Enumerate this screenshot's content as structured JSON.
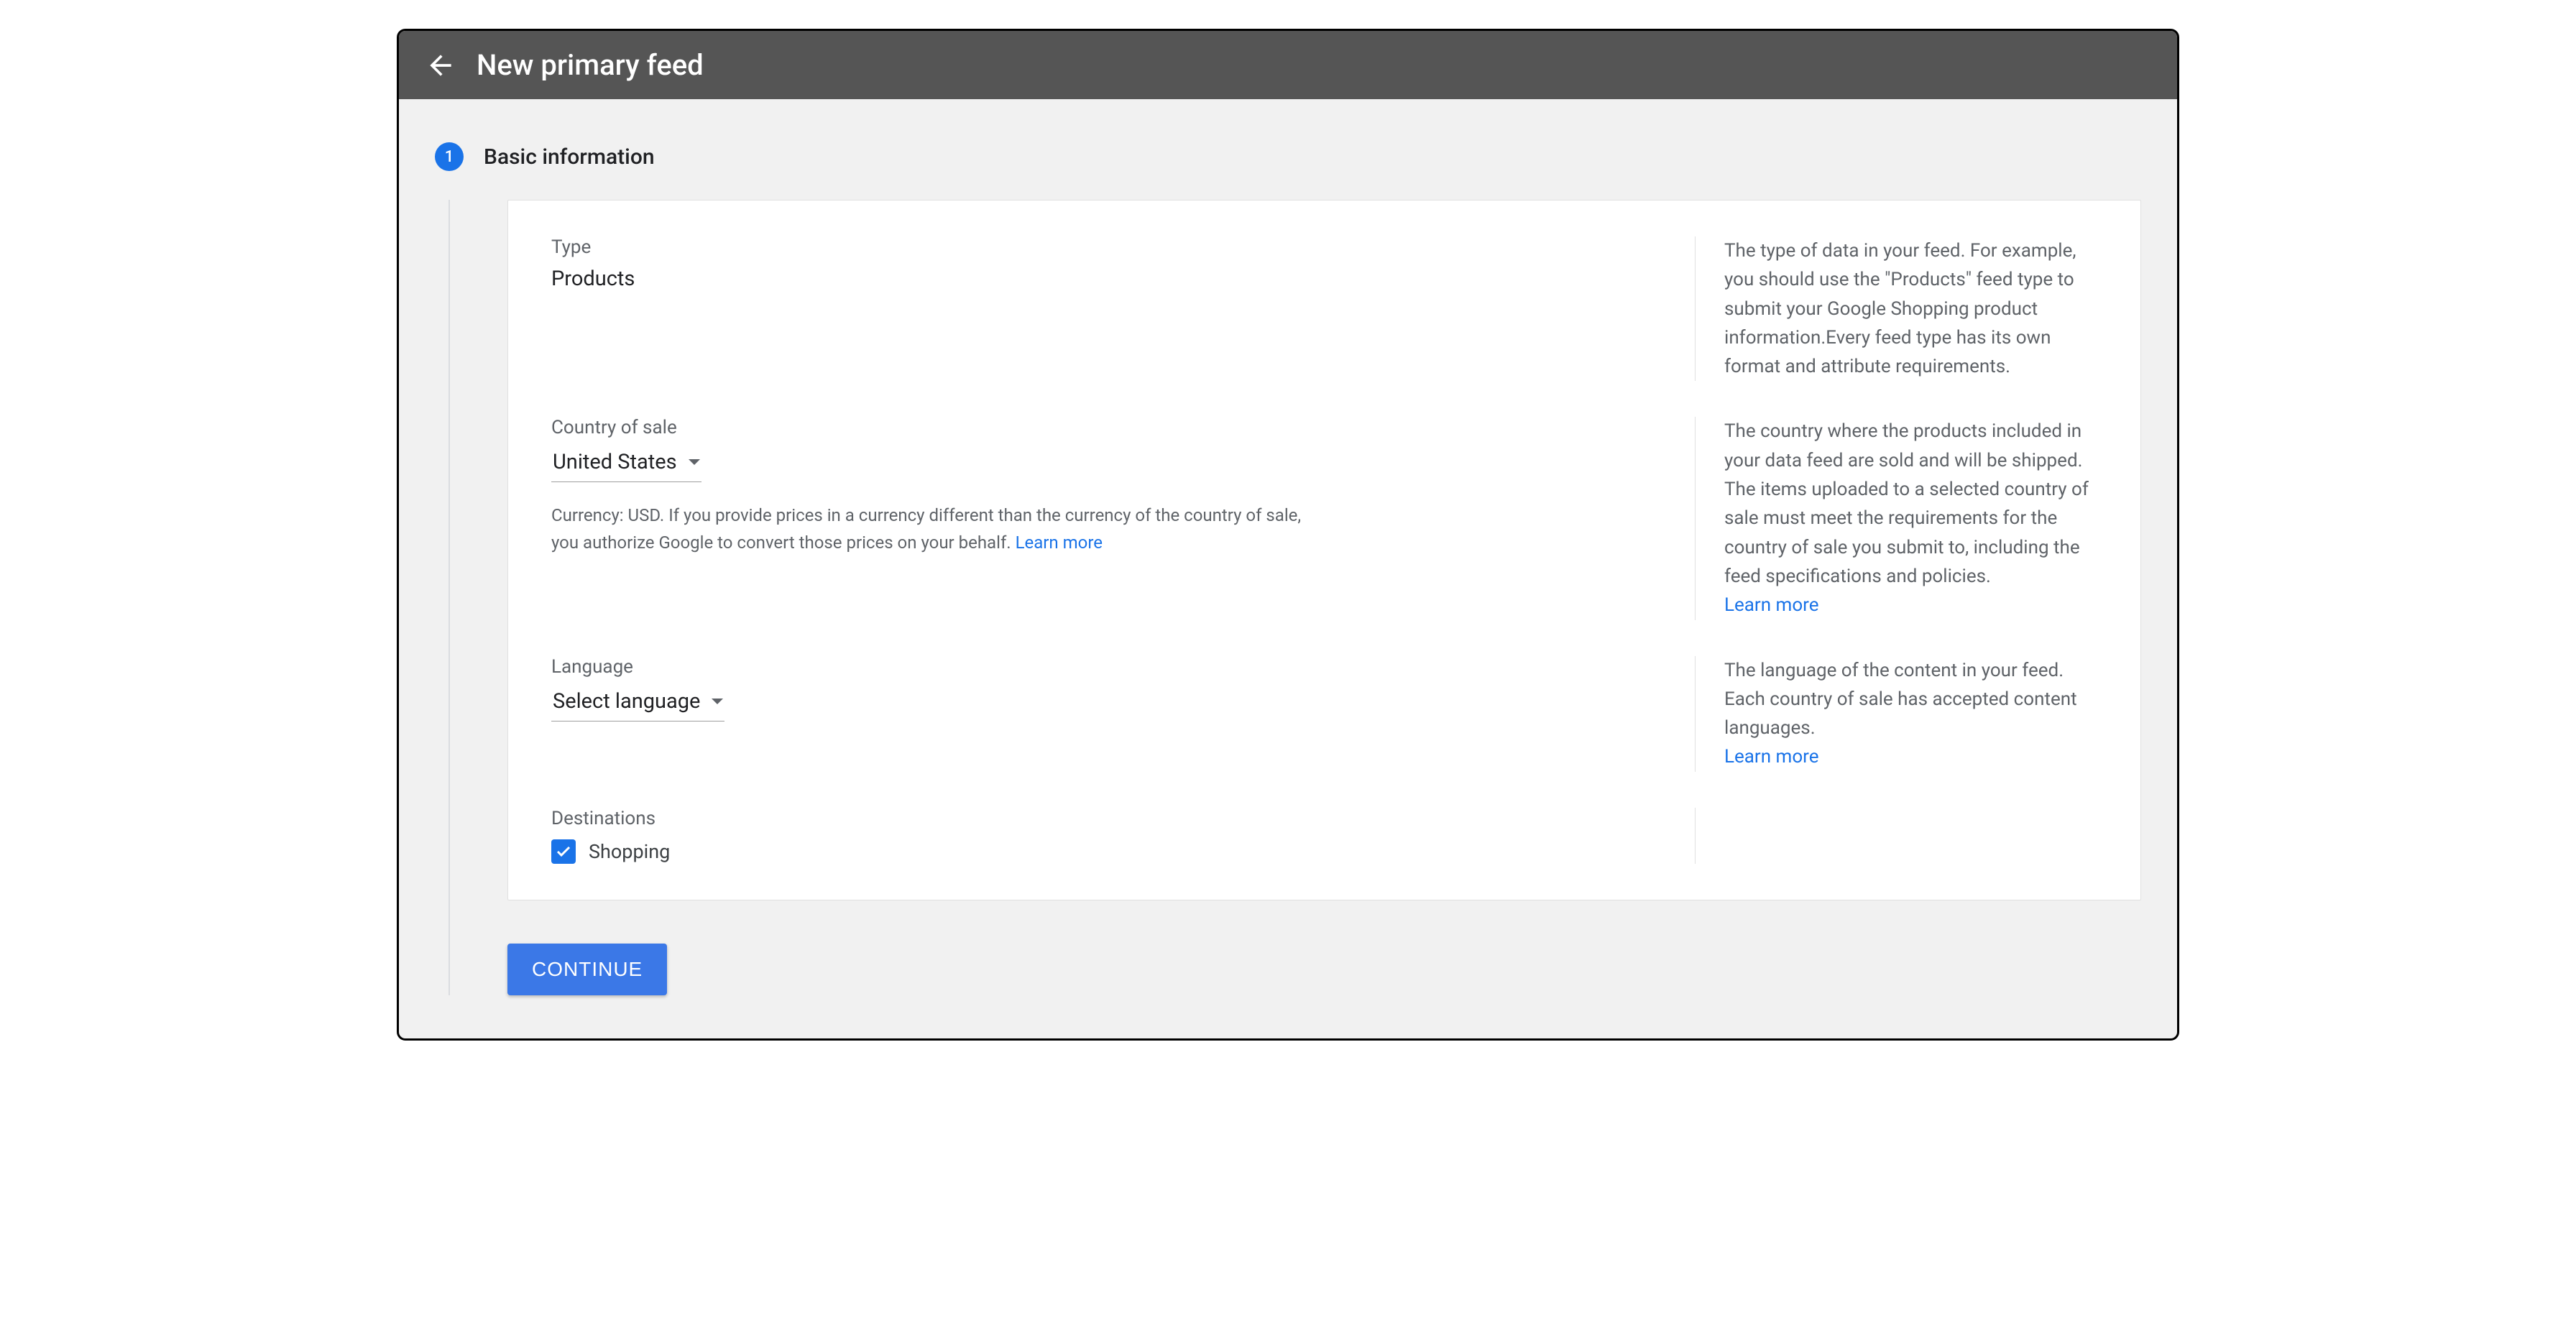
{
  "header": {
    "title": "New primary feed"
  },
  "step": {
    "number": "1",
    "title": "Basic information"
  },
  "type_section": {
    "label": "Type",
    "value": "Products",
    "help": "The type of data in your feed. For example, you should use the \"Products\" feed type to submit your Google Shopping product information.Every feed type has its own format and attribute requirements."
  },
  "country_section": {
    "label": "Country of sale",
    "value": "United States",
    "hint_prefix": "Currency: USD. If you provide prices in a currency different than the currency of the country of sale, you authorize Google to convert those prices on your behalf. ",
    "hint_link": "Learn more",
    "help": "The country where the products included in your data feed are sold and will be shipped. The items uploaded to a selected country of sale must meet the requirements for the country of sale you submit to, including the feed specifications and policies.",
    "help_link": "Learn more"
  },
  "language_section": {
    "label": "Language",
    "value": "Select language",
    "help": "The language of the content in your feed. Each country of sale has accepted content languages.",
    "help_link": "Learn more"
  },
  "destinations_section": {
    "label": "Destinations",
    "option": "Shopping"
  },
  "buttons": {
    "continue": "CONTINUE"
  }
}
